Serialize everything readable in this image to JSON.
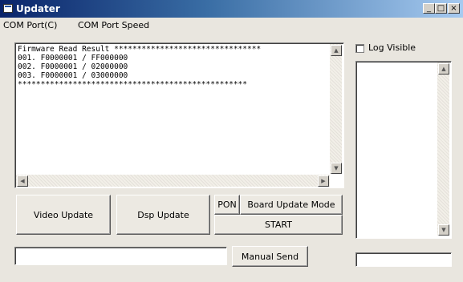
{
  "window": {
    "title": "Updater"
  },
  "menu": {
    "items": [
      "COM Port(C)",
      "COM Port Speed"
    ]
  },
  "result_box": {
    "lines": [
      "Firmware Read Result ********************************",
      "001. F0000001 / FF000000",
      "002. F0000001 / 02000000",
      "003. F0000001 / 03000000",
      "**************************************************"
    ]
  },
  "buttons": {
    "video_update": "Video Update",
    "dsp_update": "Dsp Update",
    "pon": "PON",
    "board_update_mode": "Board Update Mode",
    "start": "START",
    "manual_send": "Manual Send"
  },
  "log": {
    "visible_label": "Log Visible",
    "checked": false
  },
  "inputs": {
    "manual_value": "",
    "status_value": ""
  },
  "colors": {
    "window_bg": "#e9e6df",
    "title_start": "#0a246a",
    "title_end": "#a6caf0"
  }
}
